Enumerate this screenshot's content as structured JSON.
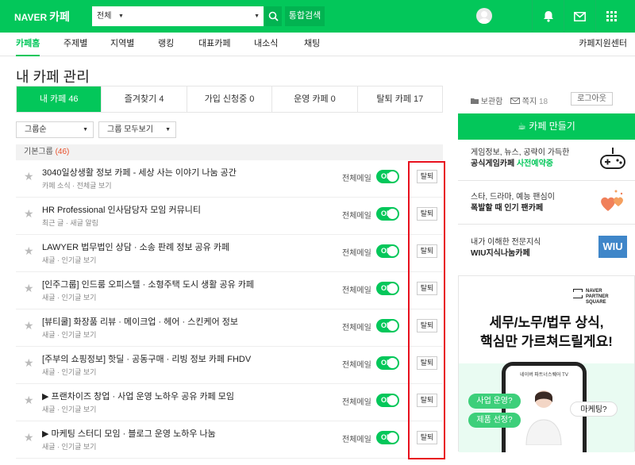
{
  "header": {
    "logo_naver": "NAVER",
    "logo_cafe": "카페",
    "search_scope": "전체",
    "search_placeholder": "",
    "total_search": "통합검색"
  },
  "gnb": {
    "items": [
      "카페홈",
      "주제별",
      "지역별",
      "랭킹",
      "대표카페",
      "내소식",
      "채팅"
    ],
    "support": "카페지원센터"
  },
  "page": {
    "title": "내 카페 관리",
    "tabs": [
      "내 카페 46",
      "즐겨찾기 4",
      "가입 신청중 0",
      "운영 카페 0",
      "탈퇴 카페 17"
    ],
    "filter_sort": "그룹순",
    "filter_group": "그룹 모두보기",
    "group_name": "기본그룹",
    "group_count": "(46)"
  },
  "rows": [
    {
      "name": "3040일상생활 정보 카페 - 세상 사는 이야기 나눔 공간",
      "sub": "카페 소식 · 전체글 보기",
      "mail": "전체메일",
      "toggle": "ON",
      "leave": "탈퇴"
    },
    {
      "name": "HR Professional 인사담당자 모임 커뮤니티",
      "sub": "최근 글 · 새글 알림",
      "mail": "전체메일",
      "toggle": "ON",
      "leave": "탈퇴"
    },
    {
      "name": "LAWYER 법무법인 상담 · 소송 판례 정보 공유 카페",
      "sub": "새글 · 인기글 보기",
      "mail": "전체메일",
      "toggle": "ON",
      "leave": "탈퇴"
    },
    {
      "name": "[인주그룹] 인드룸 오피스텔 · 소형주택 도시 생활 공유 카페",
      "sub": "새글 · 인기글 보기",
      "mail": "전체메일",
      "toggle": "ON",
      "leave": "탈퇴"
    },
    {
      "name": "[뷰티쿨] 화장품 리뷰 · 메이크업 · 헤어 · 스킨케어 정보",
      "sub": "새글 · 인기글 보기",
      "mail": "전체메일",
      "toggle": "ON",
      "leave": "탈퇴"
    },
    {
      "name": "[주부의 쇼핑정보] 핫딜 · 공동구매 · 리빙 정보 카페 FHDV",
      "sub": "새글 · 인기글 보기",
      "mail": "전체메일",
      "toggle": "ON",
      "leave": "탈퇴"
    },
    {
      "name": "▶ 프랜차이즈 창업 · 사업 운영 노하우 공유 카페 모임",
      "sub": "새글 · 인기글 보기",
      "mail": "전체메일",
      "toggle": "ON",
      "leave": "탈퇴"
    },
    {
      "name": "▶ 마케팅 스터디 모임 · 블로그 운영 노하우 나눔",
      "sub": "새글 · 인기글 보기",
      "mail": "전체메일",
      "toggle": "ON",
      "leave": "탈퇴"
    }
  ],
  "sidebar": {
    "saved": "보관함",
    "notes": "쪽지",
    "notes_count": "18",
    "logout": "로그아웃",
    "make_cafe": "카페 만들기",
    "promos": [
      {
        "line1": "게임정보, 뉴스, 공략이 가득한",
        "line2_pre": "공식게임카페 ",
        "line2_hl": "사전예약중"
      },
      {
        "line1": "스타, 드라마, 예능 팬심이",
        "line2_pre": "폭발할 때 ",
        "line2_hl": "인기 팬카페"
      },
      {
        "line1": "내가 이해한 전문지식",
        "line2_pre": "WIU지식나눔카페",
        "line2_hl": ""
      }
    ],
    "wiu_label": "WIU"
  },
  "ad": {
    "brand": "NAVER PARTNER SQUARE",
    "headline1": "세무/노무/법무 상식,",
    "headline2": "핵심만 가르쳐드릴게요!",
    "phone_title": "네이버 파트너스퀘어 TV",
    "bubble1": "사업 운영?",
    "bubble2": "제품 선정?",
    "bubble3": "마케팅?"
  },
  "colors": {
    "brand_green": "#03c75a",
    "highlight_red": "#e8101d"
  }
}
